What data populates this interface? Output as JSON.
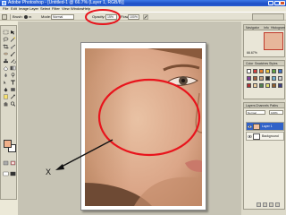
{
  "window": {
    "title": "Adobe Photoshop - [Untitled-1 @ 66.7% (Layer 1, RGB/8)]"
  },
  "menu": {
    "items": [
      "File",
      "Edit",
      "Image",
      "Layer",
      "Select",
      "Filter",
      "View",
      "Window",
      "Help"
    ]
  },
  "options_bar": {
    "brush_label": "Brush:",
    "brush_size": "65",
    "mode_label": "Mode:",
    "mode_value": "Normal",
    "opacity_label": "Opacity:",
    "opacity_value": "15%",
    "flow_label": "Flow:",
    "flow_value": "100%"
  },
  "colors": {
    "foreground": "#f0b08a",
    "background": "#ffffff",
    "annotation_red": "#e8141c"
  },
  "navigator": {
    "tabs": [
      "Navigator",
      "Info",
      "Histogram"
    ],
    "zoom": "66.67%"
  },
  "swatches_panel": {
    "tabs": [
      "Color",
      "Swatches",
      "Styles"
    ]
  },
  "layers_panel": {
    "tabs": [
      "Layers",
      "Channels",
      "Paths"
    ],
    "blend_mode": "Normal",
    "opacity": "100%",
    "layers": [
      {
        "name": "Layer 1",
        "active": true
      },
      {
        "name": "Background",
        "active": false
      }
    ]
  },
  "annotation": {
    "marker_label": "X"
  }
}
